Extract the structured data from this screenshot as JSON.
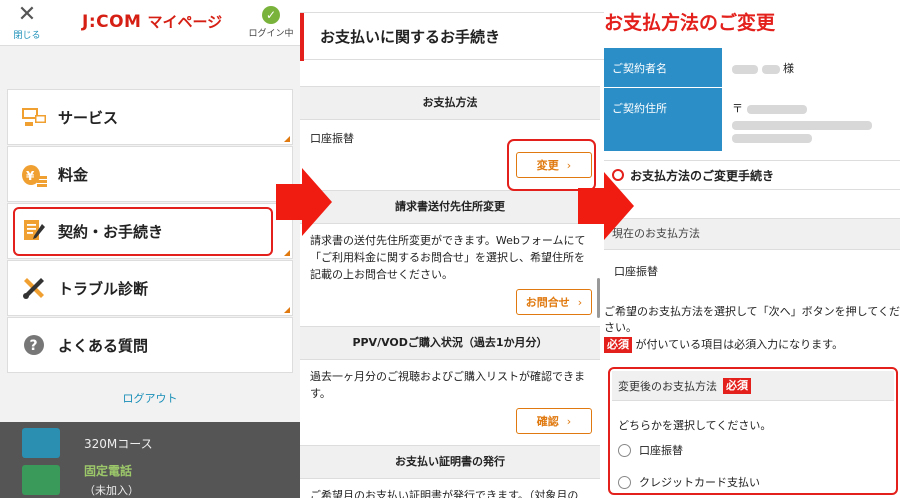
{
  "panel1": {
    "close_label": "閉じる",
    "logo_main": "J:COM",
    "logo_sub": "マイページ",
    "login_label": "ログイン中",
    "menu": [
      {
        "label": "サービス",
        "icon": "devices-icon"
      },
      {
        "label": "料金",
        "icon": "money-bag-icon"
      },
      {
        "label": "契約・お手続き",
        "icon": "contract-icon"
      },
      {
        "label": "トラブル診断",
        "icon": "tools-icon"
      },
      {
        "label": "よくある質問",
        "icon": "question-icon"
      }
    ],
    "logout": "ログアウト",
    "background": {
      "internet_plan": "320Mコース",
      "phone_title": "固定電話",
      "phone_status": "（未加入）"
    }
  },
  "panel2": {
    "title": "お支払いに関するお手続き",
    "payment_method": {
      "header": "お支払方法",
      "value": "口座振替",
      "button": "変更"
    },
    "billing_address": {
      "header": "請求書送付先住所変更",
      "text": "請求書の送付先住所変更ができます。Webフォームにて「ご利用料金に関するお問合せ」を選択し、希望住所を記載の上お問合せください。",
      "button": "お問合せ"
    },
    "ppv": {
      "header": "PPV/VODご購入状況（過去1か月分）",
      "text": "過去一ヶ月分のご視聴およびご購入リストが確認できます。",
      "button": "確認"
    },
    "certificate": {
      "header": "お支払い証明書の発行",
      "text": "ご希望月のお支払い証明書が発行できます。（対象月の"
    }
  },
  "panel3": {
    "title": "お支払方法のご変更",
    "contractor_label": "ご契約者名",
    "contractor_suffix": "様",
    "address_label": "ご契約住所",
    "postal_mark": "〒",
    "section_title": "お支払方法のご変更手続き",
    "current_label": "現在のお支払方法",
    "current_value": "口座振替",
    "instruction": "ご希望のお支払方法を選択して「次へ」ボタンを押してください。",
    "required_badge": "必須",
    "required_note": "が付いている項目は必須入力になります。",
    "new_method_label": "変更後のお支払方法",
    "select_prompt": "どちらかを選択してください。",
    "options": [
      "口座振替",
      "クレジットカード支払い"
    ]
  },
  "colors": {
    "brand_red": "#e3201b",
    "accent_orange": "#e07a10",
    "table_blue": "#2b8ec7"
  }
}
